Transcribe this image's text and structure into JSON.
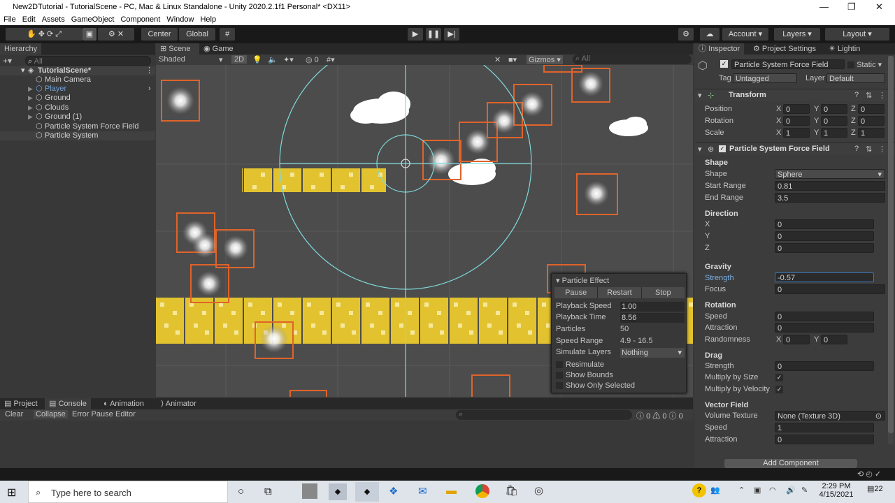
{
  "window": {
    "title": "New2DTutorial - TutorialScene - PC, Mac & Linux Standalone - Unity 2020.2.1f1 Personal* <DX11>"
  },
  "menu": [
    "File",
    "Edit",
    "Assets",
    "GameObject",
    "Component",
    "Window",
    "Help"
  ],
  "toolbar": {
    "center": "Center",
    "global": "Global",
    "account": "Account",
    "layers": "Layers",
    "layout": "Layout"
  },
  "hierarchy": {
    "tab": "Hierarchy",
    "search": "All",
    "scene": "TutorialScene*",
    "items": [
      "Main Camera",
      "Player",
      "Ground",
      "Clouds",
      "Ground (1)",
      "Particle System Force Field",
      "Particle System"
    ]
  },
  "scene_view": {
    "tabs": [
      "Scene",
      "Game"
    ],
    "shading": "Shaded",
    "mode2d": "2D",
    "hidden_count": "0",
    "gizmos": "Gizmos",
    "search": "All"
  },
  "particle_popup": {
    "title": "Particle Effect",
    "buttons": [
      "Pause",
      "Restart",
      "Stop"
    ],
    "playback_speed_label": "Playback Speed",
    "playback_speed": "1.00",
    "playback_time_label": "Playback Time",
    "playback_time": "8.56",
    "particles_label": "Particles",
    "particles": "50",
    "speed_range_label": "Speed Range",
    "speed_range": "4.9 - 16.5",
    "simulate_layers_label": "Simulate Layers",
    "simulate_layers": "Nothing",
    "checks": [
      "Resimulate",
      "Show Bounds",
      "Show Only Selected"
    ]
  },
  "bottom": {
    "tabs": [
      "Project",
      "Console",
      "Animation",
      "Animator"
    ],
    "console_buttons": [
      "Clear",
      "Collapse",
      "Error Pause",
      "Editor"
    ],
    "counts": [
      "0",
      "0",
      "0"
    ]
  },
  "inspector": {
    "tabs": [
      "Inspector",
      "Project Settings",
      "Lightin"
    ],
    "object_name": "Particle System Force Field",
    "static": "Static",
    "tag_label": "Tag",
    "tag": "Untagged",
    "layer_label": "Layer",
    "layer": "Default",
    "transform": {
      "title": "Transform",
      "rows": [
        {
          "label": "Position",
          "x": "0",
          "y": "0",
          "z": "0"
        },
        {
          "label": "Rotation",
          "x": "0",
          "y": "0",
          "z": "0"
        },
        {
          "label": "Scale",
          "x": "1",
          "y": "1",
          "z": "1"
        }
      ]
    },
    "component_title": "Particle System Force Field",
    "shape": {
      "h": "Shape",
      "shape_label": "Shape",
      "shape": "Sphere",
      "start_label": "Start Range",
      "start": "0.81",
      "end_label": "End Range",
      "end": "3.5"
    },
    "direction": {
      "h": "Direction",
      "x": "0",
      "y": "0",
      "z": "0"
    },
    "gravity": {
      "h": "Gravity",
      "strength_label": "Strength",
      "strength": "-0.57",
      "focus_label": "Focus",
      "focus": "0"
    },
    "rotation": {
      "h": "Rotation",
      "speed_label": "Speed",
      "speed": "0",
      "attraction_label": "Attraction",
      "attraction": "0",
      "random_label": "Randomness",
      "rx": "0",
      "ry": "0"
    },
    "drag": {
      "h": "Drag",
      "strength_label": "Strength",
      "strength": "0",
      "size_label": "Multiply by Size",
      "vel_label": "Multiply by Velocity"
    },
    "vector": {
      "h": "Vector Field",
      "tex_label": "Volume Texture",
      "tex": "None (Texture 3D)",
      "speed_label": "Speed",
      "speed": "1",
      "attr_label": "Attraction",
      "attr": "0"
    },
    "add_component": "Add Component"
  },
  "taskbar": {
    "search": "Type here to search",
    "time": "2:29 PM",
    "date": "4/15/2021",
    "notif": "22"
  },
  "colors": {
    "selection": "#2c5d87",
    "particle_border": "#e0632a",
    "gizmo": "#7fdadb",
    "block": "#e2c32f"
  }
}
